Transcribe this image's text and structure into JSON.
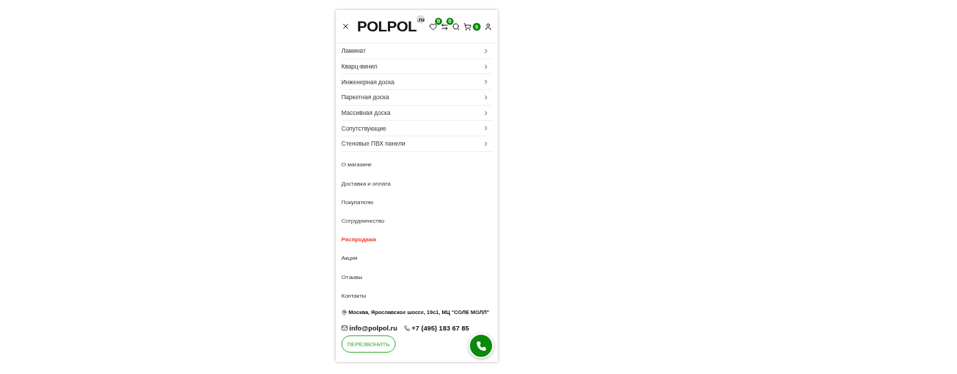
{
  "header": {
    "logo": "POLPOL",
    "logo_suffix": ".ru",
    "badges": [
      {
        "kind": "heart",
        "count": "0"
      },
      {
        "kind": "compare",
        "count": "0"
      },
      {
        "kind": "search"
      },
      {
        "kind": "cart",
        "count": "0"
      },
      {
        "kind": "user"
      }
    ]
  },
  "categories": [
    {
      "label": "Ламинат"
    },
    {
      "label": "Кварц-винил"
    },
    {
      "label": "Инженерная доска"
    },
    {
      "label": "Паркетная доска"
    },
    {
      "label": "Массивная доска"
    },
    {
      "label": "Сопутствующие"
    },
    {
      "label": "Стеновые ПВХ панели"
    }
  ],
  "links": [
    {
      "label": "О магазине",
      "highlighted": false
    },
    {
      "label": "Доставка и оплата",
      "highlighted": false
    },
    {
      "label": "Покупателю",
      "highlighted": false
    },
    {
      "label": "Сотрудничество",
      "highlighted": false
    },
    {
      "label": "Распродажа",
      "highlighted": true
    },
    {
      "label": "Акции",
      "highlighted": false
    },
    {
      "label": "Отзывы",
      "highlighted": false
    },
    {
      "label": "Контакты",
      "highlighted": false
    }
  ],
  "contacts": {
    "address": "Москва, Ярославское шоссе, 19с1, МЦ \"СОЛЕ МОЛЛ\"",
    "email": "info@polpol.ru",
    "phone": "+7 (495) 183 67 85"
  },
  "callback_button": "ПЕРЕЗВОНИТЬ"
}
